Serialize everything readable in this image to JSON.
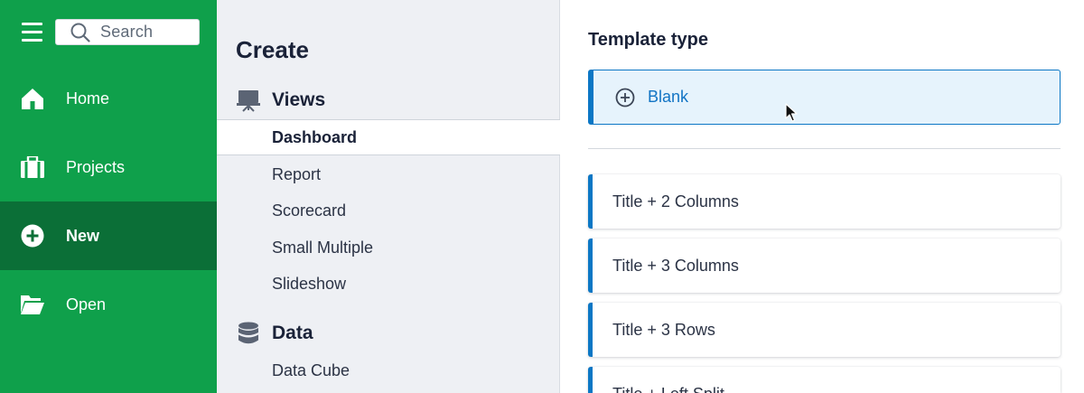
{
  "nav": {
    "search_placeholder": "Search",
    "items": [
      {
        "label": "Home",
        "icon": "home-icon"
      },
      {
        "label": "Projects",
        "icon": "briefcase-icon"
      },
      {
        "label": "New",
        "icon": "plus-circle-icon",
        "active": true
      },
      {
        "label": "Open",
        "icon": "folder-open-icon"
      }
    ],
    "colors": {
      "background": "#0fa04b",
      "active": "#0b6f37"
    }
  },
  "create": {
    "title": "Create",
    "sections": [
      {
        "label": "Views",
        "icon": "presentation-icon",
        "items": [
          "Dashboard",
          "Report",
          "Scorecard",
          "Small Multiple",
          "Slideshow"
        ],
        "selected": "Dashboard"
      },
      {
        "label": "Data",
        "icon": "database-icon",
        "items": [
          "Data Cube"
        ]
      }
    ]
  },
  "templates": {
    "title": "Template type",
    "blank_label": "Blank",
    "cards": [
      "Title + 2 Columns",
      "Title + 3 Columns",
      "Title + 3 Rows",
      "Title + Left Split"
    ],
    "accent": "#0b77c5"
  }
}
